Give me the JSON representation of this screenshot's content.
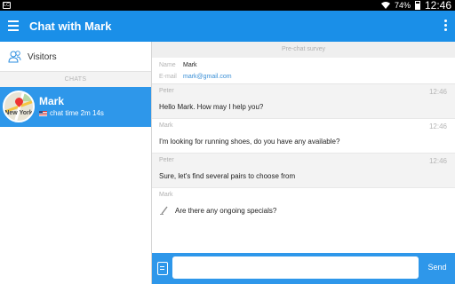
{
  "status_bar": {
    "badge": "LC",
    "battery": "74%",
    "time": "12:46"
  },
  "app_bar": {
    "title": "Chat with Mark"
  },
  "sidebar": {
    "visitors_label": "Visitors",
    "chats_header": "CHATS",
    "chat": {
      "name": "Mark",
      "avatar_city": "New York",
      "meta": "chat time 2m 14s"
    }
  },
  "conversation": {
    "survey_header": "Pre-chat survey",
    "survey": {
      "name_label": "Name",
      "name_value": "Mark",
      "email_label": "E-mail",
      "email_value": "mark@gmail.com"
    },
    "messages": [
      {
        "author": "Peter",
        "time": "12:46",
        "text": "Hello Mark. How may I help you?"
      },
      {
        "author": "Mark",
        "time": "12:46",
        "text": "I'm looking for running shoes, do you have any available?"
      },
      {
        "author": "Peter",
        "time": "12:46",
        "text": "Sure, let's find several pairs to choose from"
      },
      {
        "author": "Mark",
        "time": "",
        "text": "Are there any ongoing specials?"
      }
    ]
  },
  "input": {
    "value": "",
    "placeholder": "",
    "send_label": "Send"
  },
  "colors": {
    "primary": "#1a8fe8",
    "selected": "#2e97ea",
    "operator_bg": "#f3f3f3",
    "email_link": "#3a8fd6"
  }
}
